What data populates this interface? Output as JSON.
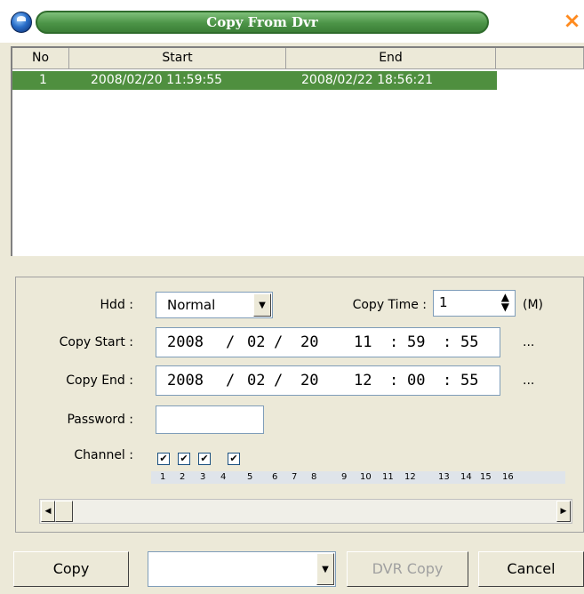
{
  "window": {
    "title": "Copy From Dvr",
    "close_glyph": "×"
  },
  "list": {
    "columns": [
      "No",
      "Start",
      "End",
      ""
    ],
    "rows": [
      {
        "no": "1",
        "start": "2008/02/20 11:59:55",
        "end": "2008/02/22 18:56:21"
      }
    ]
  },
  "form": {
    "hdd_label": "Hdd :",
    "hdd_value": "Normal",
    "copy_time_label": "Copy Time :",
    "copy_time_value": "1",
    "copy_time_unit": "(M)",
    "copy_start_label": "Copy Start :",
    "copy_start": {
      "year": "2008",
      "month": "02",
      "day": "20",
      "hour": "11",
      "minute": "59",
      "second": "55"
    },
    "copy_end_label": "Copy End :",
    "copy_end": {
      "year": "2008",
      "month": "02",
      "day": "20",
      "hour": "12",
      "minute": "00",
      "second": "55"
    },
    "ellipsis": "...",
    "password_label": "Password :",
    "password_value": "",
    "channel_label": "Channel :",
    "channels": [
      "1",
      "2",
      "3",
      "4",
      "5",
      "6",
      "7",
      "8",
      "9",
      "10",
      "11",
      "12",
      "13",
      "14",
      "15",
      "16"
    ],
    "checked_channels": [
      "1",
      "2",
      "3",
      "4"
    ]
  },
  "buttons": {
    "copy": "Copy",
    "dvr_copy": "DVR Copy",
    "cancel": "Cancel",
    "device_select_value": ""
  },
  "colors": {
    "selection": "#4f8f3f",
    "title_bar": "#4c9447",
    "close": "#ff8a1e"
  }
}
